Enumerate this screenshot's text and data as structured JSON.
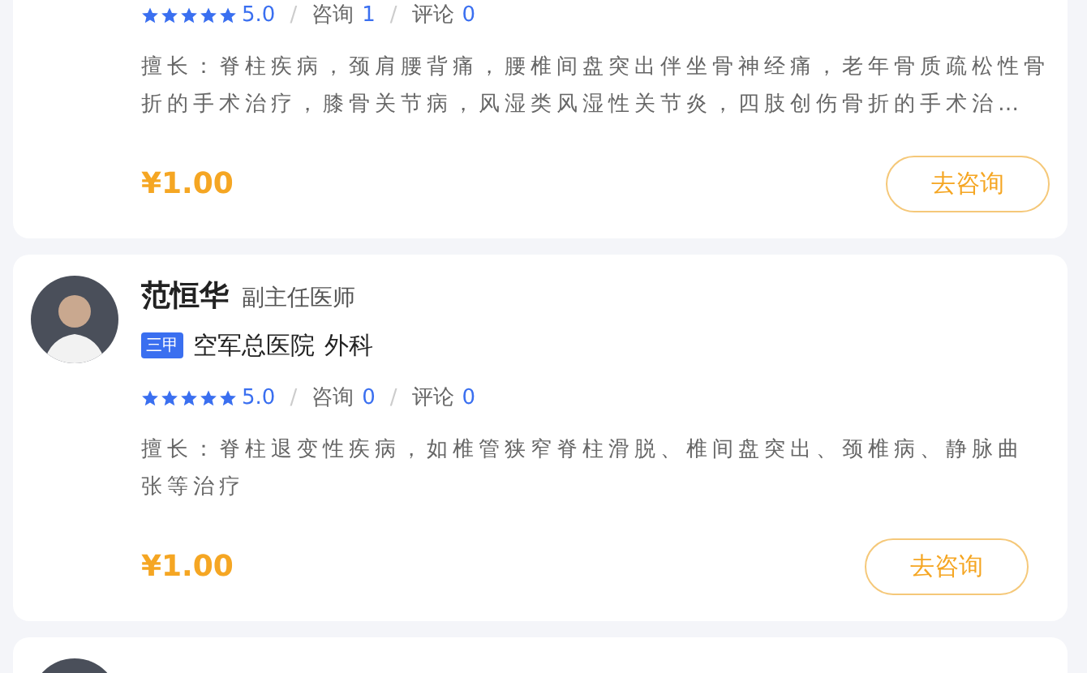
{
  "doctors": [
    {
      "avatar": false,
      "stars": 5,
      "rating": "5.0",
      "separator": "/",
      "consult_label": "咨询",
      "consult_count": "1",
      "review_label": "评论",
      "review_count": "0",
      "specialty": "擅长：脊柱疾病，颈肩腰背痛，腰椎间盘突出伴坐骨神经痛，老年骨质疏松性骨折的手术治疗，膝骨关节病，风湿类风湿性关节炎，四肢创伤骨折的手术治…",
      "price": "¥1.00",
      "button": "去咨询"
    },
    {
      "avatar": true,
      "name": "范恒华",
      "title": "副主任医师",
      "level_badge": "三甲",
      "hospital": "空军总医院",
      "department": "外科",
      "stars": 5,
      "rating": "5.0",
      "separator": "/",
      "consult_label": "咨询",
      "consult_count": "0",
      "review_label": "评论",
      "review_count": "0",
      "specialty": "擅长：脊柱退变性疾病，如椎管狭窄脊柱滑脱、椎间盘突出、颈椎病、静脉曲张等治疗",
      "price": "¥1.00",
      "button": "去咨询"
    },
    {
      "avatar": true
    }
  ]
}
